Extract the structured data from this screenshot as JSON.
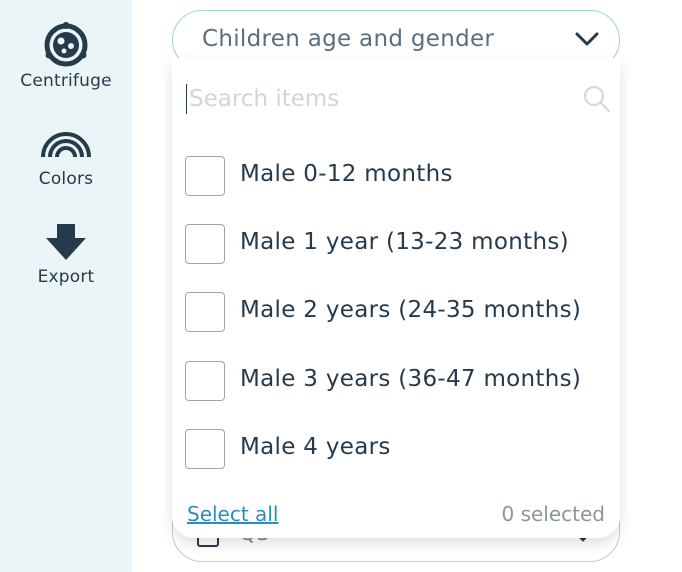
{
  "sidebar": {
    "items": [
      {
        "label": "Centrifuge",
        "icon": "centrifuge-icon"
      },
      {
        "label": "Colors",
        "icon": "rainbow-icon"
      },
      {
        "label": "Export",
        "icon": "download-arrow-icon"
      }
    ]
  },
  "select": {
    "title": "Children age and gender"
  },
  "dropdown": {
    "search_placeholder": "Search items",
    "options": [
      {
        "label": "Male 0-12 months",
        "checked": false
      },
      {
        "label": "Male 1 year (13-23 months)",
        "checked": false
      },
      {
        "label": "Male 2 years (24-35 months)",
        "checked": false
      },
      {
        "label": "Male 3 years (36-47 months)",
        "checked": false
      },
      {
        "label": "Male 4 years",
        "checked": false
      }
    ],
    "select_all_label": "Select all",
    "selected_count_text": "0 selected"
  },
  "background_select": {
    "text": "Q3"
  },
  "colors": {
    "sidebar_bg": "#ebf5f7",
    "accent_border": "#9fd5d3",
    "link": "#2a8fb8",
    "text_dark": "#253a4b"
  }
}
